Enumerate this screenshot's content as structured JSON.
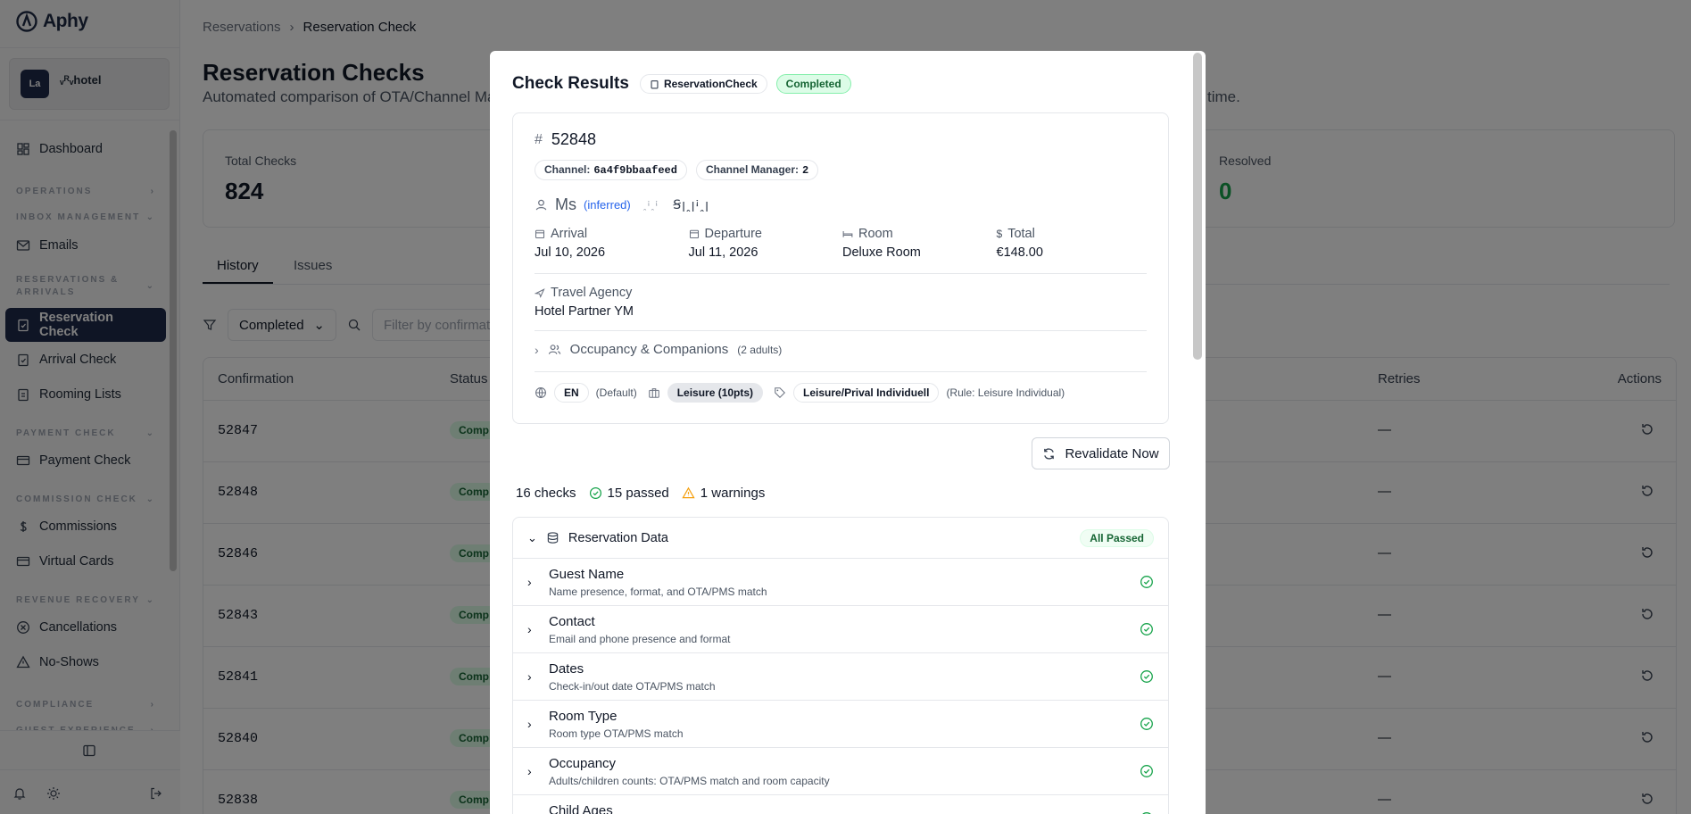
{
  "sidebar": {
    "logo": "Aphy",
    "org": {
      "avatar": "La",
      "name": "ᵥᴿᵥhotel"
    },
    "items": {
      "dashboard": "Dashboard",
      "emails": "Emails",
      "reservation_check": "Reservation Check",
      "arrival_check": "Arrival Check",
      "rooming_lists": "Rooming Lists",
      "payment_check": "Payment Check",
      "commissions": "Commissions",
      "virtual_cards": "Virtual Cards",
      "cancellations": "Cancellations",
      "no_shows": "No-Shows"
    },
    "sections": {
      "operations": "OPERATIONS",
      "inbox": "INBOX MANAGEMENT",
      "reservations": "RESERVATIONS & ARRIVALS",
      "payment": "PAYMENT CHECK",
      "commission": "COMMISSION CHECK",
      "revenue": "REVENUE RECOVERY",
      "compliance": "COMPLIANCE",
      "guest": "GUEST EXPERIENCE"
    }
  },
  "breadcrumb": {
    "parent": "Reservations",
    "current": "Reservation Check"
  },
  "page": {
    "title": "Reservation Checks",
    "subtitle": "Automated comparison of OTA/Channel Man",
    "subtitle_tail": "time."
  },
  "stats": {
    "total_label": "Total Checks",
    "total_value": "824",
    "resolved_label": "Resolved",
    "resolved_value": "0"
  },
  "tabs": {
    "history": "History",
    "issues": "Issues"
  },
  "filters": {
    "status": "Completed",
    "search_placeholder": "Filter by confirmatio"
  },
  "table": {
    "headers": {
      "confirmation": "Confirmation",
      "status": "Status",
      "retries": "Retries",
      "actions": "Actions"
    },
    "rows": [
      {
        "conf": "52847",
        "status": "Comp",
        "retries": "—"
      },
      {
        "conf": "52848",
        "status": "Comp",
        "retries": "—"
      },
      {
        "conf": "52846",
        "status": "Comp",
        "retries": "—"
      },
      {
        "conf": "52843",
        "status": "Comp",
        "retries": "—"
      },
      {
        "conf": "52841",
        "status": "Comp",
        "retries": "—"
      },
      {
        "conf": "52840",
        "status": "Comp",
        "retries": "—"
      },
      {
        "conf": "52838",
        "status": "Comp",
        "retries": "—"
      }
    ]
  },
  "modal": {
    "title": "Check Results",
    "type_pill": "ReservationCheck",
    "status_pill": "Completed",
    "reservation_id": "52848",
    "channel_label": "Channel:",
    "channel_value": "6a4f9bbaafeed",
    "cm_label": "Channel Manager:",
    "cm_value": "2",
    "guest_title": "Ms",
    "guest_inferred": "(inferred)",
    "guest_first": "ꞈꜟꞈꜟ",
    "guest_last": "Ꞩꞁꞈꞁꜟꞈꞁ",
    "arrival_label": "Arrival",
    "arrival_value": "Jul 10, 2026",
    "departure_label": "Departure",
    "departure_value": "Jul 11, 2026",
    "room_label": "Room",
    "room_value": "Deluxe Room",
    "total_label": "Total",
    "total_value": "€148.00",
    "agency_label": "Travel Agency",
    "agency_value": "Hotel Partner YM",
    "occupancy_label": "Occupancy & Companions",
    "occupancy_count": "(2 adults)",
    "lang": "EN",
    "lang_note": "(Default)",
    "segment": "Leisure (10pts)",
    "rate_tag": "Leisure/Prival Individuell",
    "rule_note": "(Rule: Leisure Individual)",
    "revalidate": "Revalidate Now",
    "summary": {
      "checks": "16 checks",
      "passed": "15 passed",
      "warnings": "1 warnings"
    },
    "section": {
      "title": "Reservation Data",
      "badge": "All Passed"
    },
    "checks": [
      {
        "name": "Guest Name",
        "desc": "Name presence, format, and OTA/PMS match"
      },
      {
        "name": "Contact",
        "desc": "Email and phone presence and format"
      },
      {
        "name": "Dates",
        "desc": "Check-in/out date OTA/PMS match"
      },
      {
        "name": "Room Type",
        "desc": "Room type OTA/PMS match"
      },
      {
        "name": "Occupancy",
        "desc": "Adults/children counts: OTA/PMS match and room capacity"
      },
      {
        "name": "Child Ages",
        "desc": ""
      }
    ]
  },
  "colors": {
    "brand": "#1e2a4a",
    "success": "#16a34a",
    "warning": "#f59e0b"
  }
}
